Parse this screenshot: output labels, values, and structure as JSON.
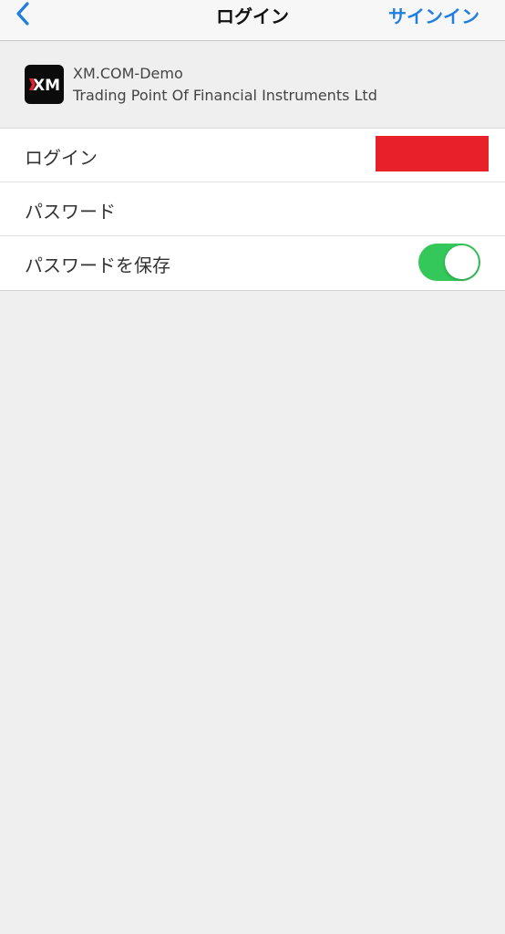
{
  "navbar": {
    "back_icon": "chevron-left-icon",
    "title": "ログイン",
    "action_label": "サインイン"
  },
  "server": {
    "logo_icon": "xm-logo-icon",
    "logo_text": "XM",
    "name": "XM.COM-Demo",
    "company": "Trading Point Of Financial Instruments Ltd"
  },
  "form": {
    "login_label": "ログイン",
    "password_label": "パスワード",
    "password_value": "",
    "save_password_label": "パスワードを保存",
    "save_password_on": true
  },
  "colors": {
    "accent": "#1e7fe0",
    "toggle_on": "#34c759",
    "redaction": "#e8202a",
    "background": "#efeff0"
  }
}
